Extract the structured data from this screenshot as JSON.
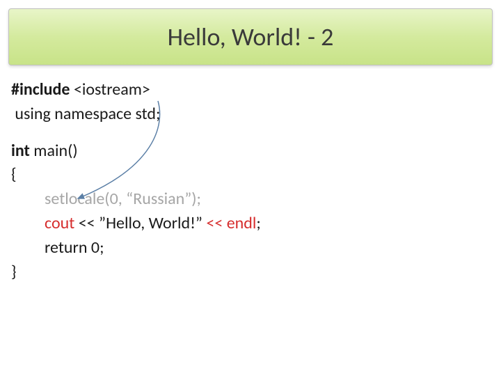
{
  "title": "Hello, World! - 2",
  "code": {
    "line1_kw": "#include",
    "line1_rest": " <iostream>",
    "line2": " using namespace std;",
    "line3_kw": "int",
    "line3_rest": " main()",
    "line4": "{",
    "line5": "setlocale(0, “Russian”);",
    "line6_a": "cout ",
    "line6_b": "<< ",
    "line6_c": "”Hello, World!” ",
    "line6_d": "<< endl",
    "line6_e": ";",
    "line7": "return 0;",
    "line8": "}"
  }
}
